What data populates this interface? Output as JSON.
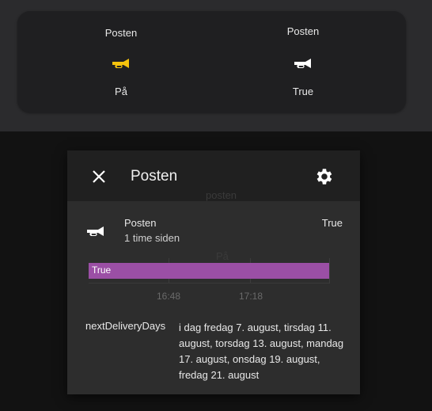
{
  "card": {
    "entities": [
      {
        "name": "Posten",
        "state": "På",
        "icon": "bugle-icon",
        "icon_color": "#f4c20d"
      },
      {
        "name": "Posten",
        "state": "True",
        "icon": "bugle-icon",
        "icon_color": "#ffffff"
      }
    ]
  },
  "background_ghost": {
    "name": "posten",
    "state": "På"
  },
  "dialog": {
    "title": "Posten",
    "close_icon": "close-icon",
    "settings_icon": "gear-icon",
    "entity": {
      "name": "Posten",
      "last_changed": "1 time siden",
      "state": "True",
      "icon": "bugle-icon"
    },
    "timeline": {
      "bar_label": "True",
      "bar_color": "#9b4fa5",
      "ticks": [
        "16:48",
        "17:18"
      ]
    },
    "attributes": [
      {
        "key": "nextDeliveryDays",
        "value": "i dag fredag 7. august, tirsdag 11. august, torsdag 13. august, mandag 17. august, onsdag 19. august, fredag 21. august"
      }
    ]
  }
}
